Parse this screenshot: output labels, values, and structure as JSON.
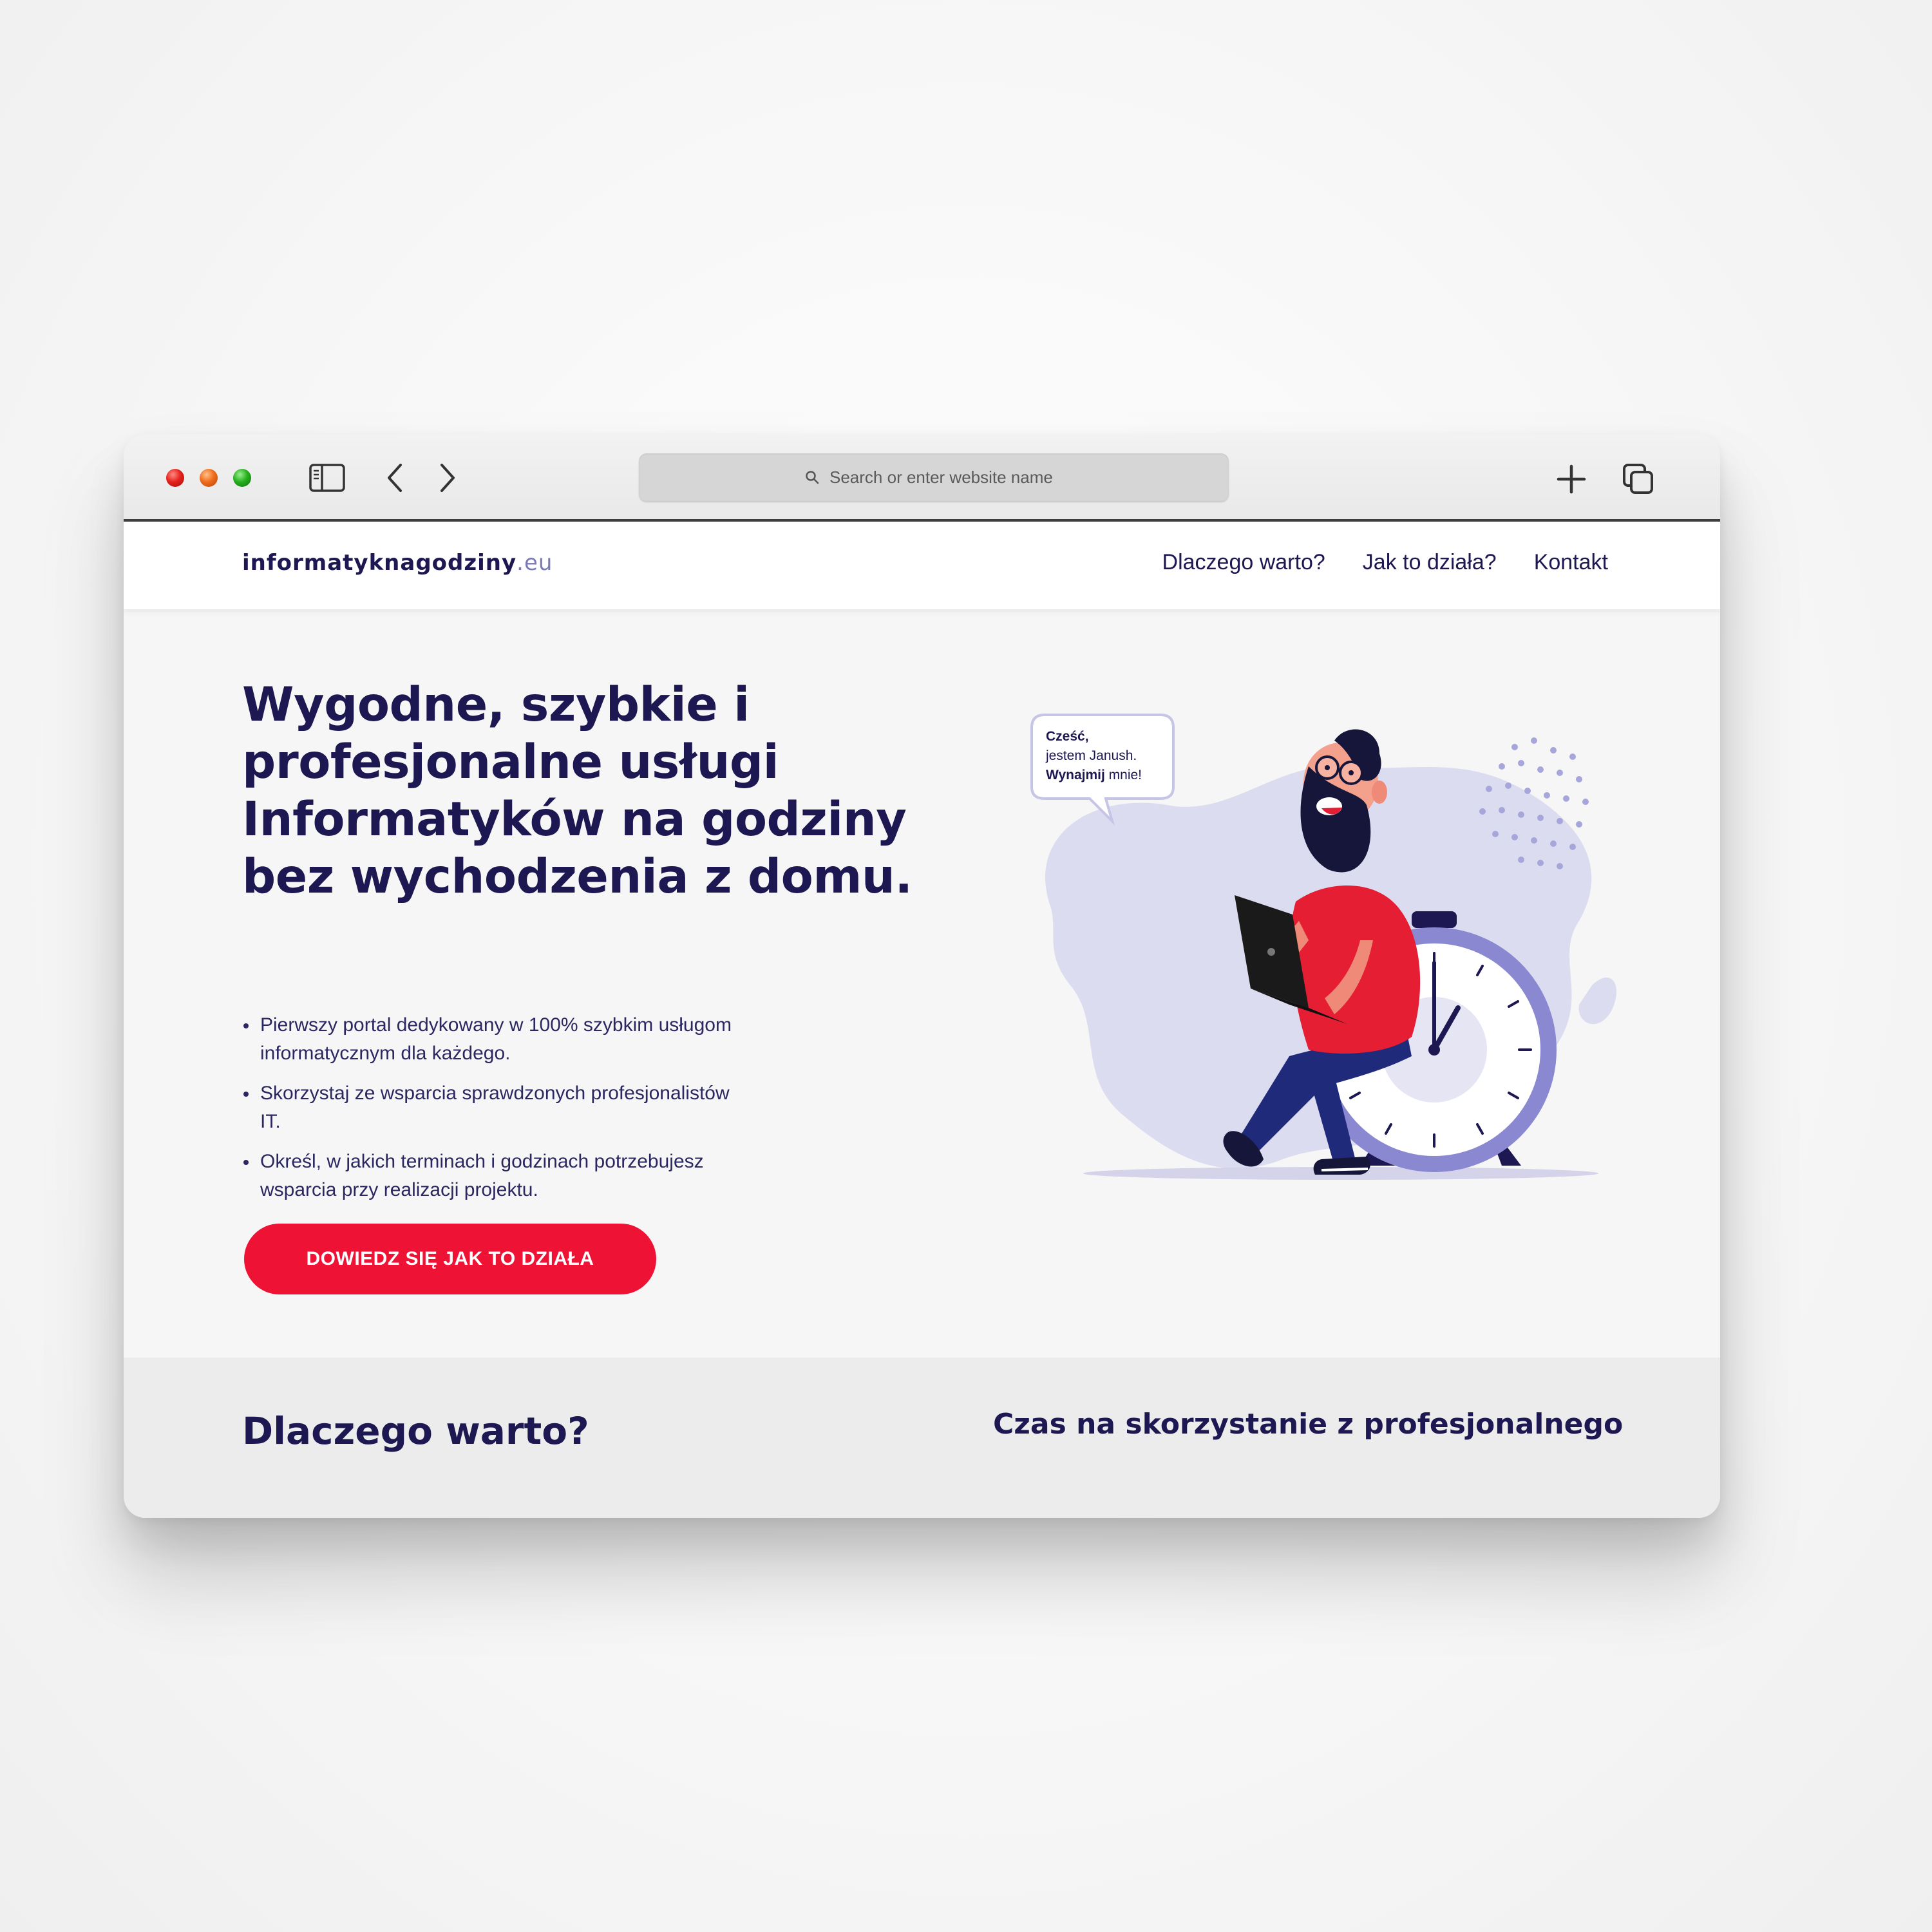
{
  "browser": {
    "address_placeholder": "Search or enter website name"
  },
  "site": {
    "logo_main": "informatyknagodziny",
    "logo_tld": ".eu",
    "nav": [
      "Dlaczego warto?",
      "Jak to działa?",
      "Kontakt"
    ]
  },
  "hero": {
    "title": "Wygodne, szybkie i profesjonalne usługi Informatyków na godziny bez wychodzenia z domu.",
    "bullets": [
      "Pierwszy portal dedykowany w 100% szybkim usługom informatycznym dla każdego.",
      "Skorzystaj ze wsparcia sprawdzonych profesjonalistów IT.",
      "Określ, w jakich terminach i godzinach potrzebujesz wsparcia przy realizacji projektu."
    ],
    "cta_label": "DOWIEDZ SIĘ JAK TO DZIAŁA",
    "speech": {
      "line1": "Cześć,",
      "line2": "jestem Janush.",
      "line3_bold": "Wynajmij",
      "line3_rest": " mnie!"
    }
  },
  "lower": {
    "left_heading": "Dlaczego warto?",
    "right_heading": "Czas na skorzystanie z profesjonalnego"
  },
  "colors": {
    "navy": "#1d1752",
    "accent_red": "#ee1235",
    "lavender": "#d9d9ef",
    "clock_purple": "#7b78c4"
  },
  "icons": [
    "sidebar-icon",
    "chevron-left-icon",
    "chevron-right-icon",
    "search-icon",
    "plus-icon",
    "tabs-icon"
  ]
}
